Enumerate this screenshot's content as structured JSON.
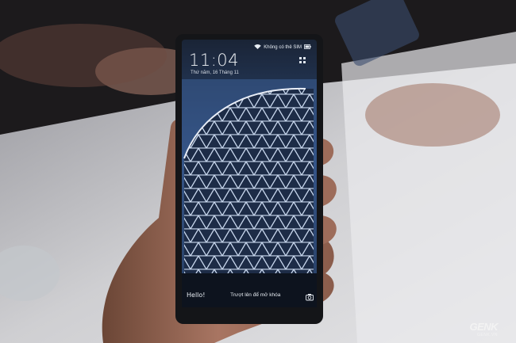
{
  "phone": {
    "status_text": "Không có thẻ SIM",
    "time": "11:04",
    "date": "Thứ năm, 16 Tháng 11",
    "hello_brand": "Hello!",
    "unlock_hint": "Trượt lên để mở khóa",
    "top_icon": "grid-icon",
    "camera_icon": "camera-icon"
  },
  "watermark": {
    "logo": "GENK",
    "url": "GENK.VN"
  }
}
